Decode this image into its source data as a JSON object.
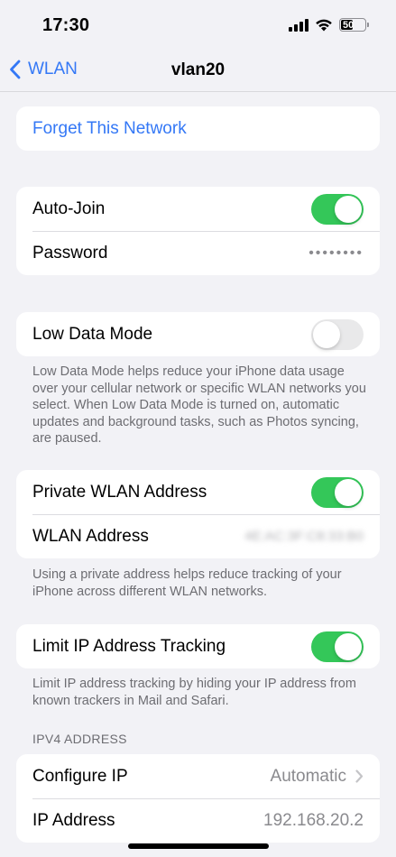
{
  "status_bar": {
    "time": "17:30",
    "battery_level": "50"
  },
  "nav": {
    "back_label": "WLAN",
    "title": "vlan20"
  },
  "forget": {
    "label": "Forget This Network"
  },
  "auto_join": {
    "label": "Auto-Join",
    "on": true
  },
  "password": {
    "label": "Password",
    "value": "••••••••"
  },
  "low_data": {
    "label": "Low Data Mode",
    "on": false,
    "footnote": "Low Data Mode helps reduce your iPhone data usage over your cellular network or specific WLAN networks you select. When Low Data Mode is turned on, automatic updates and background tasks, such as Photos syncing, are paused."
  },
  "private_address": {
    "label": "Private WLAN Address",
    "on": true,
    "wlan_address_label": "WLAN Address",
    "wlan_address_value": "4E:AC:3F:C8:33:B0",
    "footnote": "Using a private address helps reduce tracking of your iPhone across different WLAN networks."
  },
  "limit_ip": {
    "label": "Limit IP Address Tracking",
    "on": true,
    "footnote": "Limit IP address tracking by hiding your IP address from known trackers in Mail and Safari."
  },
  "ipv4": {
    "header": "IPV4 ADDRESS",
    "configure_label": "Configure IP",
    "configure_value": "Automatic",
    "ip_label": "IP Address",
    "ip_value": "192.168.20.2"
  },
  "colors": {
    "accent": "#3478f6",
    "toggle_on": "#34c759",
    "toggle_off": "#e9e9ea",
    "background": "#f2f2f6"
  }
}
